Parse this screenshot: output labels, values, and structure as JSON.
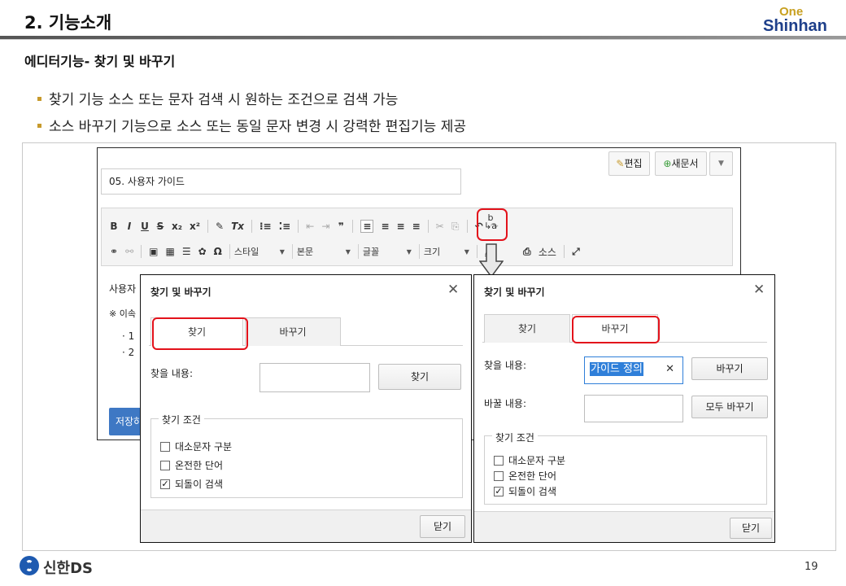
{
  "header": {
    "title": "2. 기능소개",
    "logo_one": "One",
    "logo_brand": "Shinhan"
  },
  "section_title": "에디터기능- 찾기 및 바꾸기",
  "bullets": [
    "찾기 기능 소스 또는 문자 검색 시 원하는 조건으로 검색 가능",
    "소스 바꾸기 기능으로 소스 또는 동일 문자 변경 시 강력한 편집기능 제공"
  ],
  "editor": {
    "edit_button": "편집",
    "new_doc_button": "새문서",
    "more_icon": "▼",
    "doc_title": "05. 사용자 가이드",
    "combos": {
      "style": "스타일",
      "format": "본문",
      "font": "글꼴",
      "size": "크기"
    },
    "source_button": "소스",
    "body_line1": "사용자",
    "body_line2": "※ 이속",
    "body_line3": "· 1",
    "body_line4": "· 2",
    "save_button": "저장하"
  },
  "find_dialog": {
    "title": "찾기 및 바꾸기",
    "tab_find": "찾기",
    "tab_replace": "바꾸기",
    "find_label": "찾을 내용:",
    "find_value": "",
    "find_button": "찾기",
    "conditions_legend": "찾기 조건",
    "options": [
      {
        "label": "대소문자 구분",
        "checked": false
      },
      {
        "label": "온전한 단어",
        "checked": false
      },
      {
        "label": "되돌이 검색",
        "checked": true
      }
    ],
    "close_button": "닫기"
  },
  "replace_dialog": {
    "title": "찾기 및 바꾸기",
    "tab_find": "찾기",
    "tab_replace": "바꾸기",
    "find_label": "찾을 내용:",
    "find_value": "가이드 정의",
    "replace_button": "바꾸기",
    "replace_label": "바꿀 내용:",
    "replace_value": "",
    "replace_all_button": "모두 바꾸기",
    "conditions_legend": "찾기 조건",
    "options": [
      {
        "label": "대소문자 구분",
        "checked": false
      },
      {
        "label": "온전한 단어",
        "checked": false
      },
      {
        "label": "되돌이 검색",
        "checked": true
      }
    ],
    "close_button": "닫기"
  },
  "footer": {
    "company": "신한DS",
    "page_number": "19"
  },
  "colors": {
    "highlight_red": "#e3121b",
    "brand_blue": "#1e3f8a",
    "brand_gold": "#c8a020",
    "bullet_gold": "#c79a2c",
    "save_blue": "#3e78c4"
  }
}
